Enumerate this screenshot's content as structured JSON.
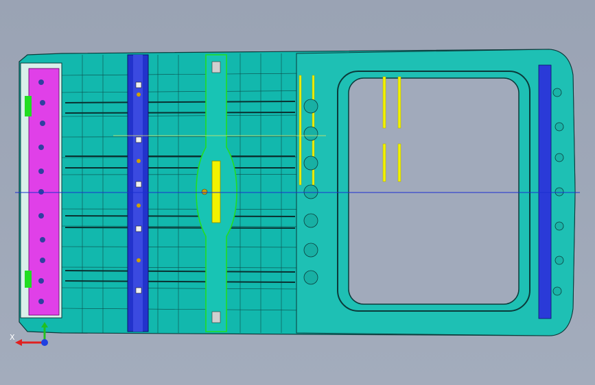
{
  "view": {
    "background_top": "#9aa3b4",
    "background_bottom": "#a3acbc",
    "model": "vehicle-roof-panel-assembly",
    "colors": {
      "panel": "#12b8ad",
      "panel_light": "#22c8bd",
      "edge": "#0b3a3a",
      "rail": "#2233cc",
      "magenta_part": "#e040e8",
      "green_part": "#22dd22",
      "yellow_part": "#f2f200",
      "centerline": "#1a2fd0"
    }
  },
  "triad": {
    "x_label": "X",
    "x_color": "#e02020",
    "y_color": "#20c020",
    "z_color": "#2040e0"
  }
}
